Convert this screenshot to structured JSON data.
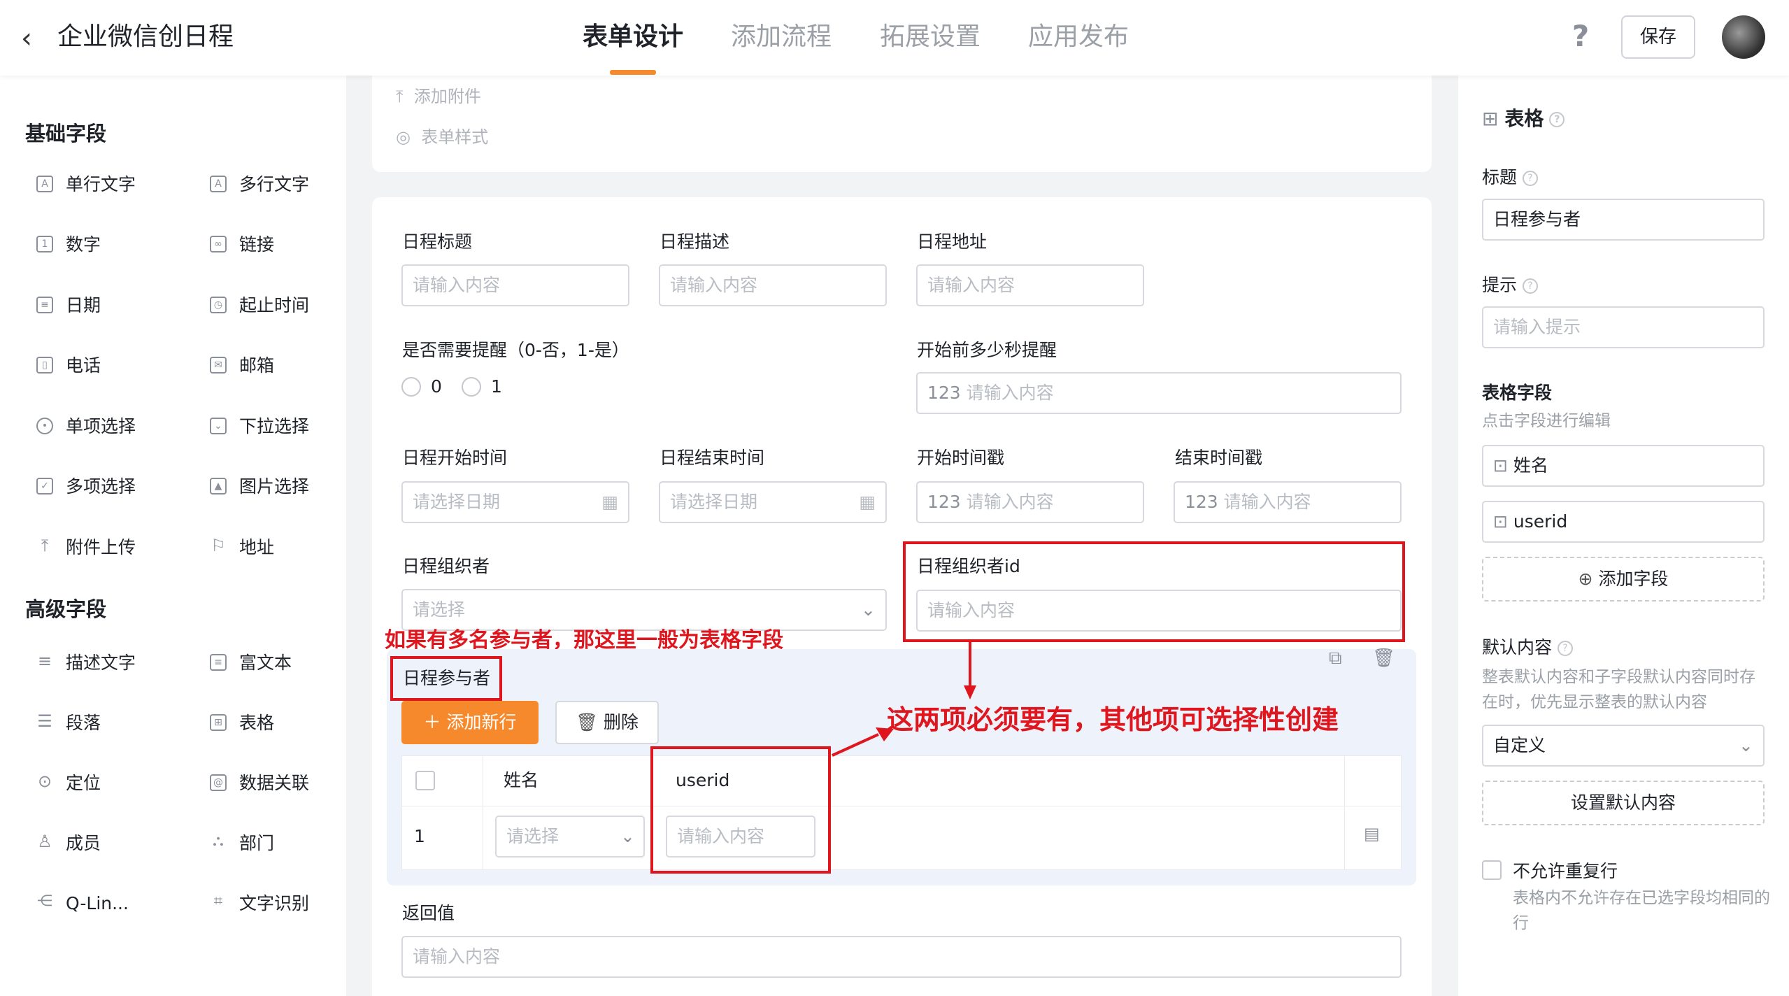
{
  "header": {
    "title": "企业微信创日程",
    "tabs": [
      "表单设计",
      "添加流程",
      "拓展设置",
      "应用发布"
    ],
    "help": "?",
    "save": "保存"
  },
  "left": {
    "basic_title": "基础字段",
    "basic": [
      "单行文字",
      "多行文字",
      "数字",
      "链接",
      "日期",
      "起止时间",
      "电话",
      "邮箱",
      "单项选择",
      "下拉选择",
      "多项选择",
      "图片选择",
      "附件上传",
      "地址"
    ],
    "advanced_title": "高级字段",
    "advanced": [
      "描述文字",
      "富文本",
      "段落",
      "表格",
      "定位",
      "数据关联",
      "成员",
      "部门",
      "Q-Lin...",
      "文字识别"
    ]
  },
  "top_card": {
    "attach": "添加附件",
    "style": "表单样式"
  },
  "form": {
    "f1": {
      "label": "日程标题",
      "ph": "请输入内容"
    },
    "f2": {
      "label": "日程描述",
      "ph": "请输入内容"
    },
    "f3": {
      "label": "日程地址",
      "ph": "请输入内容"
    },
    "remind": {
      "label": "是否需要提醒（0-否，1-是）",
      "opt0": "0",
      "opt1": "1"
    },
    "before": {
      "label": "开始前多少秒提醒",
      "ph": "请输入内容"
    },
    "start": {
      "label": "日程开始时间",
      "ph": "请选择日期"
    },
    "end": {
      "label": "日程结束时间",
      "ph": "请选择日期"
    },
    "startts": {
      "label": "开始时间戳",
      "ph": "请输入内容"
    },
    "endts": {
      "label": "结束时间戳",
      "ph": "请输入内容"
    },
    "organizer": {
      "label": "日程组织者",
      "ph": "请选择"
    },
    "organizer_id": {
      "label": "日程组织者id",
      "ph": "请输入内容"
    },
    "table": {
      "label": "日程参与者",
      "add_row": "添加新行",
      "delete": "删除",
      "col_name": "姓名",
      "col_userid": "userid",
      "row_index": "1",
      "row_select_ph": "请选择",
      "row_input_ph": "请输入内容"
    },
    "ret": {
      "label": "返回值",
      "ph": "请输入内容"
    }
  },
  "annotations": {
    "note1": "如果有多名参与者，那这里一般为表格字段",
    "note2": "这两项必须要有，其他项可选择性创建"
  },
  "right": {
    "type": "表格",
    "title_label": "标题",
    "title_value": "日程参与者",
    "hint_label": "提示",
    "hint_ph": "请输入提示",
    "fields_label": "表格字段",
    "fields_hint": "点击字段进行编辑",
    "field1": "姓名",
    "field2": "userid",
    "add_field": "添加字段",
    "default_label": "默认内容",
    "default_hint": "整表默认内容和子字段默认内容同时存在时，优先显示整表的默认内容",
    "default_select": "自定义",
    "set_default": "设置默认内容",
    "no_dup": "不允许重复行",
    "no_dup_hint": "表格内不允许存在已选字段均相同的行"
  },
  "colors": {
    "accent": "#f5892c",
    "annotation": "#e0161f"
  }
}
